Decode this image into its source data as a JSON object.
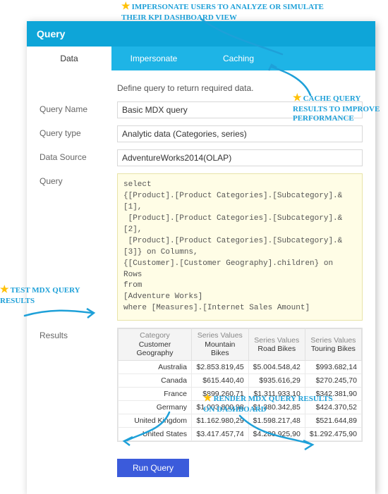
{
  "header": {
    "title": "Query"
  },
  "tabs": [
    {
      "label": "Data",
      "active": true
    },
    {
      "label": "Impersonate",
      "active": false
    },
    {
      "label": "Caching",
      "active": false
    }
  ],
  "hint": "Define query to return required data.",
  "fields": {
    "queryNameLabel": "Query Name",
    "queryName": "Basic MDX query",
    "queryTypeLabel": "Query type",
    "queryType": "Analytic data (Categories, series)",
    "dataSourceLabel": "Data Source",
    "dataSource": "AdventureWorks2014(OLAP)",
    "queryLabel": "Query",
    "queryText": "select\n{[Product].[Product Categories].[Subcategory].&[1],\n [Product].[Product Categories].[Subcategory].&[2],\n [Product].[Product Categories].[Subcategory].&[3]} on Columns,\n{[Customer].[Customer Geography].children} on Rows\nfrom\n[Adventure Works]\nwhere [Measures].[Internet Sales Amount]",
    "resultsLabel": "Results"
  },
  "results": {
    "headers": [
      {
        "top": "Category",
        "sub": "Customer Geography"
      },
      {
        "top": "Series Values",
        "sub": "Mountain Bikes"
      },
      {
        "top": "Series Values",
        "sub": "Road Bikes"
      },
      {
        "top": "Series Values",
        "sub": "Touring Bikes"
      }
    ],
    "rows": [
      {
        "c0": "Australia",
        "c1": "$2.853.819,45",
        "c2": "$5.004.548,42",
        "c3": "$993.682,14"
      },
      {
        "c0": "Canada",
        "c1": "$615.440,40",
        "c2": "$935.616,29",
        "c3": "$270.245,70"
      },
      {
        "c0": "France",
        "c1": "$899.260,71",
        "c2": "$1.311.933,10",
        "c3": "$342.381,90"
      },
      {
        "c0": "Germany",
        "c1": "$1.003.800,98",
        "c2": "$1.380.342,85",
        "c3": "$424.370,52"
      },
      {
        "c0": "United Kingdom",
        "c1": "$1.162.980,29",
        "c2": "$1.598.217,48",
        "c3": "$521.644,89"
      },
      {
        "c0": "United States",
        "c1": "$3.417.457,74",
        "c2": "$4.289.925,90",
        "c3": "$1.292.475,90"
      }
    ]
  },
  "runButton": "Run Query",
  "annotations": {
    "top": "IMPERSONATE USERS TO ANALYZE OR SIMULATE THEIR KPI DASHBOARD VIEW",
    "cache": "CACHE QUERY RESULTS TO IMPROVE PERFORMANCE",
    "test": "TEST MDX QUERY RESULTS",
    "render": "RENDER MDX QUERY RESULTS ON DASHBOARD"
  }
}
